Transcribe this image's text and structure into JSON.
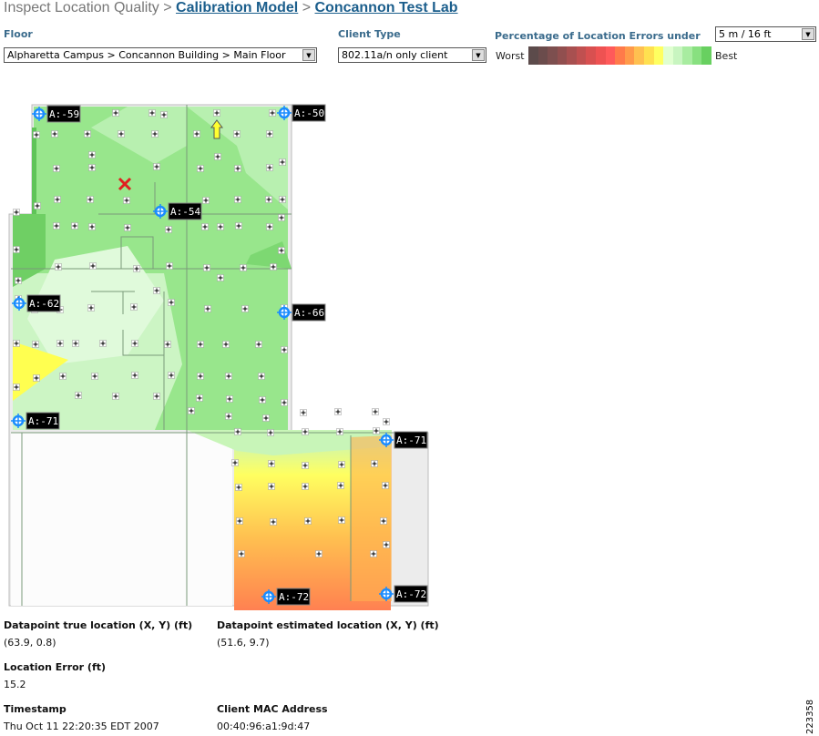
{
  "breadcrumb": {
    "root": "Inspect Location Quality",
    "sep": ">",
    "link1": "Calibration Model",
    "link2": "Concannon Test Lab"
  },
  "floor": {
    "label": "Floor",
    "value": "Alpharetta Campus > Concannon Building > Main Floor"
  },
  "client_type": {
    "label": "Client Type",
    "value": "802.11a/n only client"
  },
  "errors": {
    "label": "Percentage of Location Errors under",
    "value": "5 m / 16 ft"
  },
  "legend": {
    "worst": "Worst",
    "best": "Best",
    "colors": [
      "#5c4b4b",
      "#6b4c4c",
      "#7d4f4f",
      "#914f4f",
      "#a85050",
      "#c05050",
      "#d85050",
      "#ee5252",
      "#ff5a5a",
      "#ff7a4a",
      "#ff9a4a",
      "#ffc050",
      "#ffe050",
      "#ffff60",
      "#e0ffd0",
      "#c8f5c0",
      "#a8eca0",
      "#88e080",
      "#68d060"
    ]
  },
  "access_points": [
    {
      "label": "A:-59"
    },
    {
      "label": "A:-50"
    },
    {
      "label": "A:-54"
    },
    {
      "label": "A:-62"
    },
    {
      "label": "A:-66"
    },
    {
      "label": "A:-71"
    },
    {
      "label": "A:-71"
    },
    {
      "label": "A:-72"
    },
    {
      "label": "A:-72"
    }
  ],
  "icons": {
    "true_location": "red-x-icon",
    "estimated_location": "yellow-arrow-icon",
    "access_point": "crosshair-icon",
    "datapoint": "plus-icon"
  },
  "details": {
    "true_loc_label": "Datapoint true location (X, Y) (ft)",
    "true_loc_value": "(63.9, 0.8)",
    "est_loc_label": "Datapoint estimated location (X, Y) (ft)",
    "est_loc_value": "(51.6, 9.7)",
    "error_label": "Location Error (ft)",
    "error_value": "15.2",
    "timestamp_label": "Timestamp",
    "timestamp_value": "Thu Oct 11 22:20:35 EDT 2007",
    "mac_label": "Client MAC Address",
    "mac_value": "00:40:96:a1:9d:47"
  },
  "figure_id": "223358"
}
